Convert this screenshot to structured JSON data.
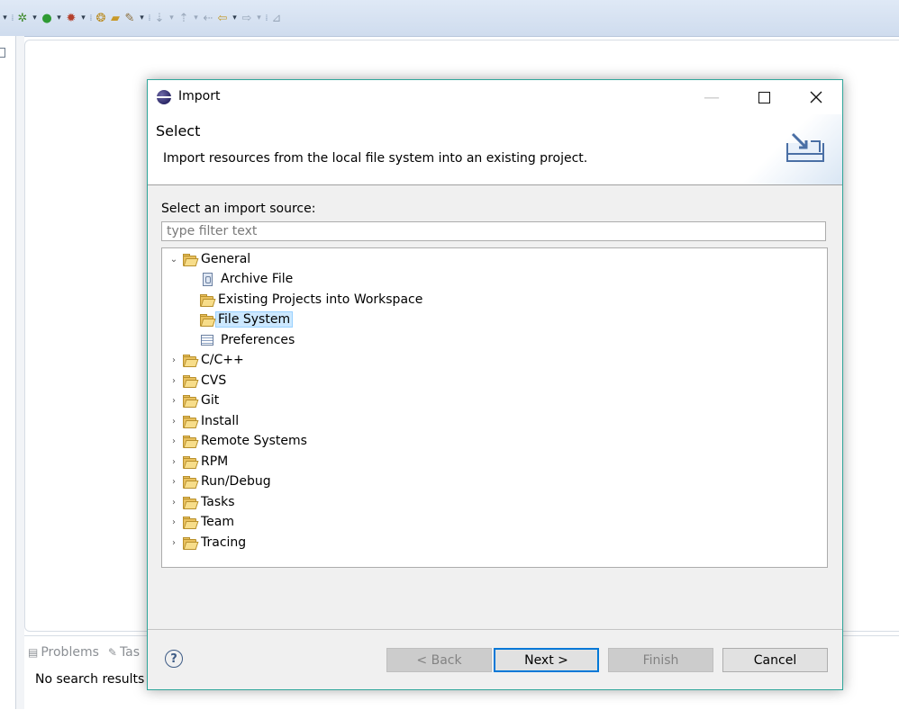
{
  "workbench": {
    "toolbar_icons": [
      "build-icon",
      "run-icon",
      "debug-icon",
      "new-project-icon",
      "open-folder-icon",
      "open-task-icon",
      "next-annotation-icon",
      "prev-annotation-icon",
      "last-edit-icon",
      "back-icon",
      "forward-icon",
      "pin-icon"
    ],
    "bottom_tabs": [
      {
        "label": "Problems",
        "icon": "problems-icon"
      },
      {
        "label": "Tas",
        "icon": "tasks-icon"
      }
    ],
    "bottom_message": "No search results av"
  },
  "dialog": {
    "title": "Import",
    "header_title": "Select",
    "header_description": "Import resources from the local file system into an existing project.",
    "source_label": "Select an import source:",
    "filter_placeholder": "type filter text",
    "tree": [
      {
        "label": "General",
        "expanded": true,
        "children": [
          {
            "label": "Archive File",
            "icon": "archive-file-icon"
          },
          {
            "label": "Existing Projects into Workspace",
            "icon": "import-project-icon"
          },
          {
            "label": "File System",
            "icon": "folder-icon",
            "selected": true
          },
          {
            "label": "Preferences",
            "icon": "preferences-icon"
          }
        ]
      },
      {
        "label": "C/C++",
        "expanded": false
      },
      {
        "label": "CVS",
        "expanded": false
      },
      {
        "label": "Git",
        "expanded": false
      },
      {
        "label": "Install",
        "expanded": false
      },
      {
        "label": "Remote Systems",
        "expanded": false
      },
      {
        "label": "RPM",
        "expanded": false
      },
      {
        "label": "Run/Debug",
        "expanded": false
      },
      {
        "label": "Tasks",
        "expanded": false
      },
      {
        "label": "Team",
        "expanded": false
      },
      {
        "label": "Tracing",
        "expanded": false
      }
    ],
    "buttons": {
      "back": "< Back",
      "next": "Next >",
      "finish": "Finish",
      "cancel": "Cancel",
      "help": "?"
    }
  }
}
